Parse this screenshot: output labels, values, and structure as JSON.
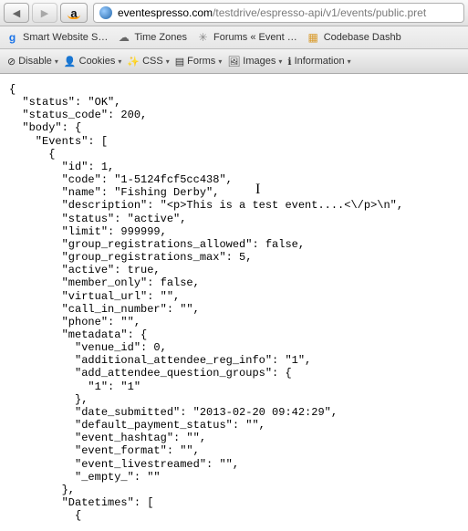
{
  "nav": {
    "back_glyph": "◀",
    "forward_glyph": "▶",
    "amazon_label": "a"
  },
  "url": {
    "host": "eventespresso.com",
    "path": "/testdrive/espresso-api/v1/events/public.pret"
  },
  "bookmarks": {
    "b1": "Smart Website S…",
    "b2": "Time Zones",
    "b3": "Forums « Event …",
    "b4": "Codebase Dashb"
  },
  "devbar": {
    "disable": "Disable",
    "cookies": "Cookies",
    "css": "CSS",
    "forms": "Forms",
    "images": "Images",
    "info": "Information"
  },
  "json_text": "{\n  \"status\": \"OK\",\n  \"status_code\": 200,\n  \"body\": {\n    \"Events\": [\n      {\n        \"id\": 1,\n        \"code\": \"1-5124fcf5cc438\",\n        \"name\": \"Fishing Derby\",\n        \"description\": \"<p>This is a test event....<\\/p>\\n\",\n        \"status\": \"active\",\n        \"limit\": 999999,\n        \"group_registrations_allowed\": false,\n        \"group_registrations_max\": 5,\n        \"active\": true,\n        \"member_only\": false,\n        \"virtual_url\": \"\",\n        \"call_in_number\": \"\",\n        \"phone\": \"\",\n        \"metadata\": {\n          \"venue_id\": 0,\n          \"additional_attendee_reg_info\": \"1\",\n          \"add_attendee_question_groups\": {\n            \"1\": \"1\"\n          },\n          \"date_submitted\": \"2013-02-20 09:42:29\",\n          \"default_payment_status\": \"\",\n          \"event_hashtag\": \"\",\n          \"event_format\": \"\",\n          \"event_livestreamed\": \"\",\n          \"_empty_\": \"\"\n        },\n        \"Datetimes\": [\n          {"
}
